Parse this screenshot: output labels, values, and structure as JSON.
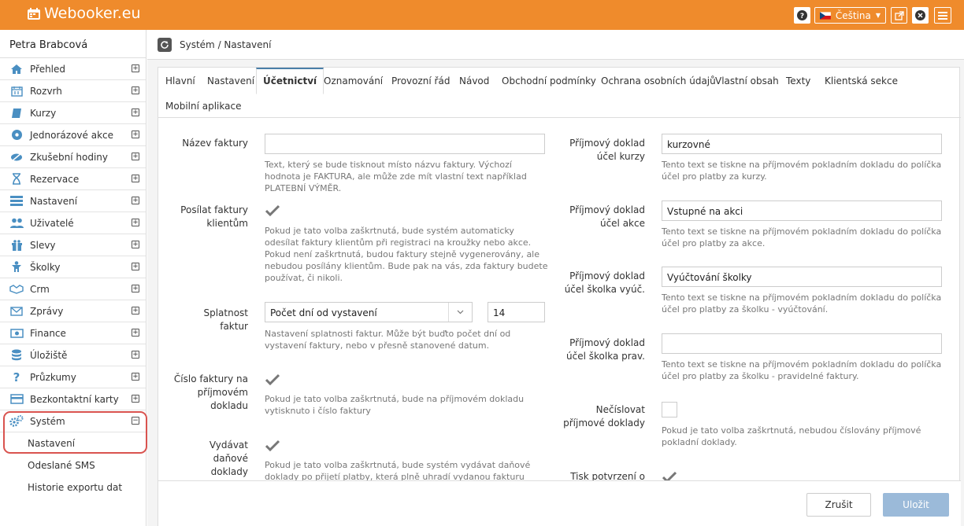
{
  "app": {
    "logo_text": "Webooker.eu"
  },
  "topbar": {
    "language": "Čeština"
  },
  "sidebar": {
    "user": "Petra Brabcová",
    "items": [
      {
        "label": "Přehled",
        "icon": "home-icon"
      },
      {
        "label": "Rozvrh",
        "icon": "calendar-icon"
      },
      {
        "label": "Kurzy",
        "icon": "book-icon"
      },
      {
        "label": "Jednorázové akce",
        "icon": "ball-icon"
      },
      {
        "label": "Zkušební hodiny",
        "icon": "eye-off-icon"
      },
      {
        "label": "Rezervace",
        "icon": "hourglass-icon"
      },
      {
        "label": "Nastavení",
        "icon": "settings-bars-icon"
      },
      {
        "label": "Uživatelé",
        "icon": "users-icon"
      },
      {
        "label": "Slevy",
        "icon": "gift-icon"
      },
      {
        "label": "Školky",
        "icon": "child-icon"
      },
      {
        "label": "Crm",
        "icon": "handshake-icon"
      },
      {
        "label": "Zprávy",
        "icon": "envelope-icon"
      },
      {
        "label": "Finance",
        "icon": "money-icon"
      },
      {
        "label": "Úložiště",
        "icon": "database-icon"
      },
      {
        "label": "Průzkumy",
        "icon": "question-icon"
      },
      {
        "label": "Bezkontaktní karty",
        "icon": "card-icon"
      },
      {
        "label": "Systém",
        "icon": "gears-icon"
      }
    ],
    "subitems": [
      "Nastavení",
      "Odeslané SMS",
      "Historie exportu dat"
    ]
  },
  "breadcrumb": "Systém / Nastavení",
  "tabs": [
    "Hlavní",
    "Nastavení",
    "Účetnictví",
    "Oznamování",
    "Provozní řád",
    "Návod",
    "Obchodní podmínky",
    "Ochrana osobních údajů",
    "Vlastní obsah",
    "Texty",
    "Klientská sekce",
    "Mobilní aplikace"
  ],
  "left": {
    "invoice_name": {
      "label": "Název faktury",
      "value": "",
      "help": "Text, který se bude tisknout místo názvu faktury. Výchozí hodnota je FAKTURA, ale může zde mít vlastní text například PLATEBNÍ VÝMĚR."
    },
    "send_invoices": {
      "label": "Posílat faktury klientům",
      "checked": true,
      "help": "Pokud je tato volba zaškrtnutá, bude systém automaticky odesílat faktury klientům při registraci na kroužky nebo akce. Pokud není zaškrtnutá, budou faktury stejně vygenerovány, ale nebudou posílány klientům. Bude pak na vás, zda faktury budete používat, či nikoli."
    },
    "due": {
      "label": "Splatnost faktur",
      "select": "Počet dní od vystavení",
      "days": "14",
      "help": "Nastavení splatnosti faktur. Může být buďto počet dní od vystavení faktury, nebo v přesně stanovené datum."
    },
    "invoice_number": {
      "label": "Číslo faktury na příjmovém dokladu",
      "checked": true,
      "help": "Pokud je tato volba zaškrtnutá, bude na příjmovém dokladu vytisknuto i číslo faktury"
    },
    "tax_docs": {
      "label": "Vydávat daňové doklady",
      "checked": true,
      "help": "Pokud je tato volba zaškrtnutá, bude systém vydávat daňové doklady po přijetí platby, která plně uhradí vydanou fakturu"
    }
  },
  "right": {
    "courses": {
      "label": "Příjmový doklad účel kurzy",
      "value": "kurzovné",
      "help": "Tento text se tiskne na příjmovém pokladním dokladu do políčka účel pro platby za kurzy."
    },
    "events": {
      "label": "Příjmový doklad účel akce",
      "value": "Vstupné na akci",
      "help": "Tento text se tiskne na příjmovém pokladním dokladu do políčka účel pro platby za akce."
    },
    "kinder_billing": {
      "label": "Příjmový doklad účel školka vyúč.",
      "value": "Vyúčtování školky",
      "help": "Tento text se tiskne na příjmovém pokladním dokladu do políčka účel pro platby za školku - vyúčtování."
    },
    "kinder_regular": {
      "label": "Příjmový doklad účel školka prav.",
      "value": "",
      "help": "Tento text se tiskne na příjmovém pokladním dokladu do políčka účel pro platby za školku - pravidelné faktury."
    },
    "no_numbering": {
      "label": "Nečíslovat příjmové doklady",
      "checked": false,
      "help": "Pokud je tato volba zaškrtnutá, nebudou číslovány příjmové pokladní doklady."
    },
    "print_confirm": {
      "label": "Tisk potvrzení o",
      "checked": true
    }
  },
  "footer": {
    "cancel": "Zrušit",
    "save": "Uložit"
  },
  "colors": {
    "topbar": "#ef8b2c",
    "highlight": "#d9534f",
    "save": "#9bbad9",
    "tab_accent": "#4a7fa8"
  }
}
